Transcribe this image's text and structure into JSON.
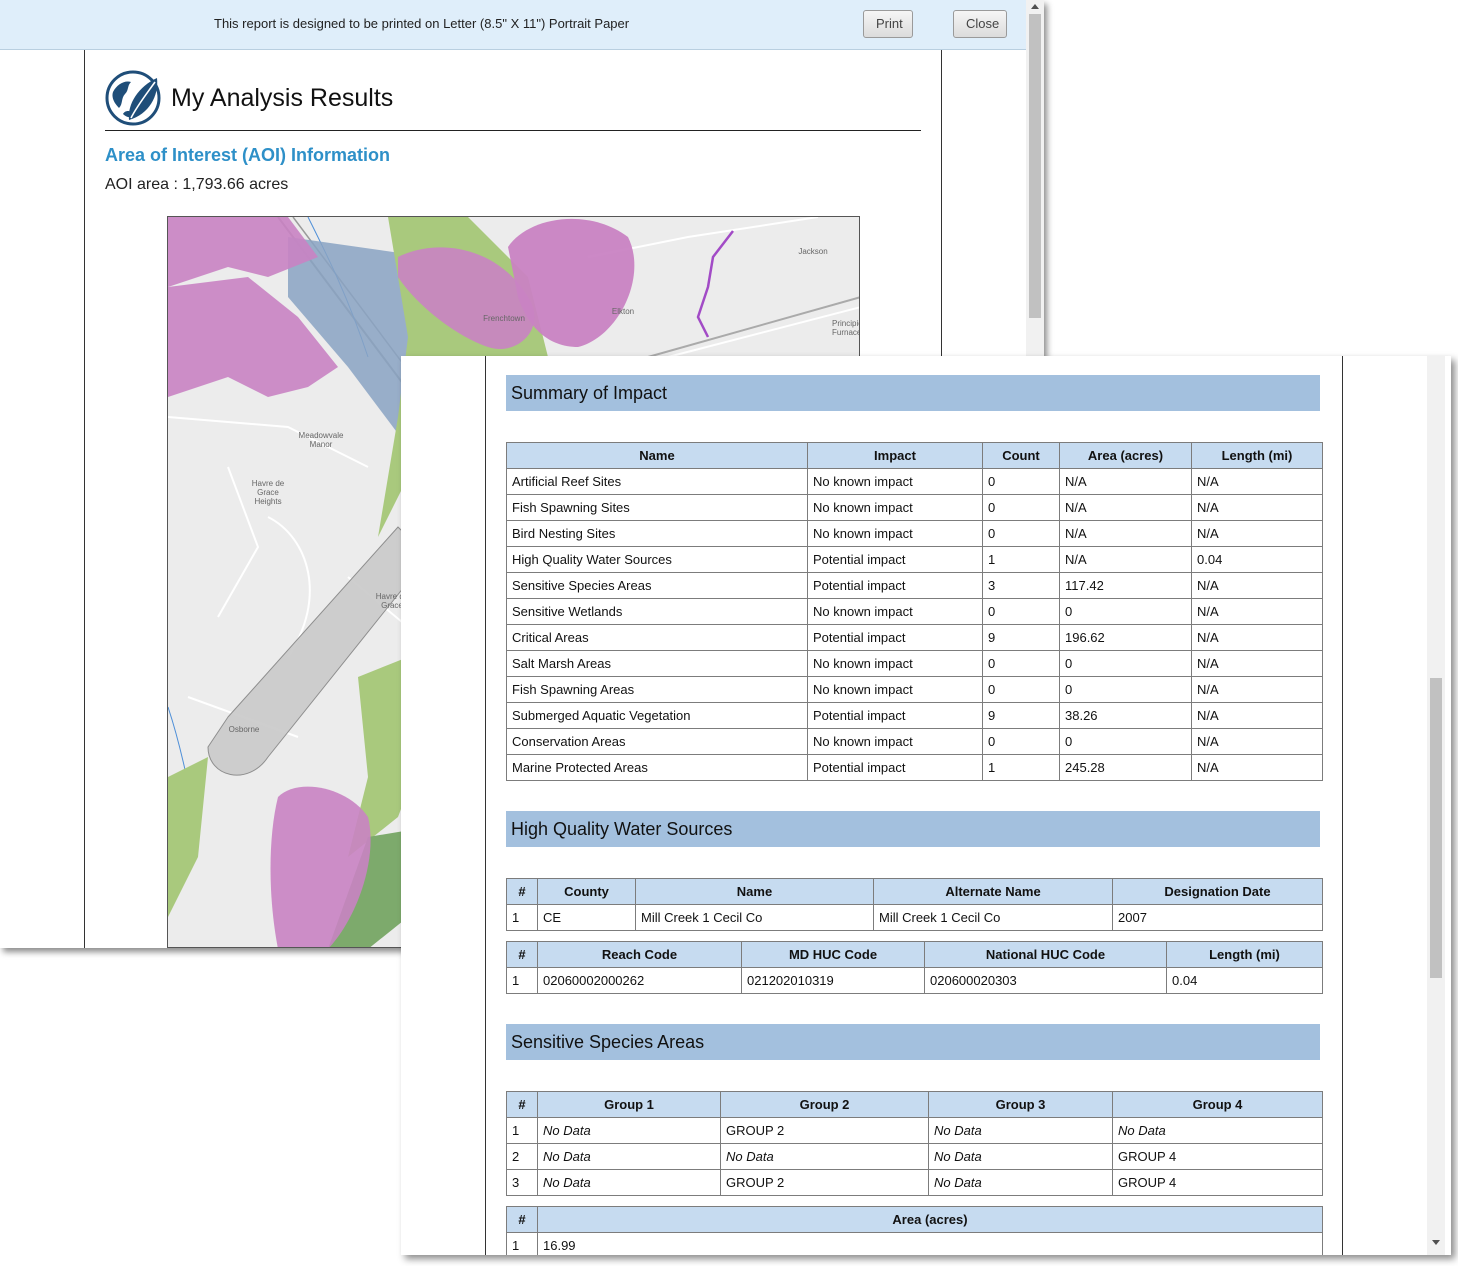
{
  "print_bar": {
    "message": "This report is designed to be printed on Letter (8.5\" X 11\") Portrait Paper",
    "print_label": "Print",
    "close_label": "Close"
  },
  "report": {
    "title": "My Analysis Results",
    "aoi_heading": "Area of Interest (AOI) Information",
    "aoi_area": "AOI area : 1,793.66 acres"
  },
  "map": {
    "labels": [
      "Jackson",
      "Frenchtown",
      "Elkton",
      "Principio Furnace",
      "Meadowvale Manor",
      "Havre de Grace Heights",
      "Havre de Grace",
      "Osborne"
    ],
    "colors": {
      "purple": "#c983c3",
      "green": "#a9c97d",
      "blue": "#8aa3c3",
      "grey": "#c9c9c9",
      "base": "#ececec"
    }
  },
  "summary": {
    "heading": "Summary of Impact",
    "columns": [
      "Name",
      "Impact",
      "Count",
      "Area (acres)",
      "Length (mi)"
    ],
    "rows": [
      [
        "Artificial Reef Sites",
        "No known impact",
        "0",
        "N/A",
        "N/A"
      ],
      [
        "Fish Spawning Sites",
        "No known impact",
        "0",
        "N/A",
        "N/A"
      ],
      [
        "Bird Nesting Sites",
        "No known impact",
        "0",
        "N/A",
        "N/A"
      ],
      [
        "High Quality Water Sources",
        "Potential impact",
        "1",
        "N/A",
        "0.04"
      ],
      [
        "Sensitive Species Areas",
        "Potential impact",
        "3",
        "117.42",
        "N/A"
      ],
      [
        "Sensitive Wetlands",
        "No known impact",
        "0",
        "0",
        "N/A"
      ],
      [
        "Critical Areas",
        "Potential impact",
        "9",
        "196.62",
        "N/A"
      ],
      [
        "Salt Marsh Areas",
        "No known impact",
        "0",
        "0",
        "N/A"
      ],
      [
        "Fish Spawning Areas",
        "No known impact",
        "0",
        "0",
        "N/A"
      ],
      [
        "Submerged Aquatic Vegetation",
        "Potential impact",
        "9",
        "38.26",
        "N/A"
      ],
      [
        "Conservation Areas",
        "No known impact",
        "0",
        "0",
        "N/A"
      ],
      [
        "Marine Protected Areas",
        "Potential impact",
        "1",
        "245.28",
        "N/A"
      ]
    ]
  },
  "water": {
    "heading": "High Quality Water Sources",
    "table1": {
      "columns": [
        "#",
        "County",
        "Name",
        "Alternate Name",
        "Designation Date"
      ],
      "rows": [
        [
          "1",
          "CE",
          "Mill Creek 1 Cecil Co",
          "Mill Creek 1 Cecil Co",
          "2007"
        ]
      ]
    },
    "table2": {
      "columns": [
        "#",
        "Reach Code",
        "MD HUC Code",
        "National HUC Code",
        "Length (mi)"
      ],
      "rows": [
        [
          "1",
          "02060002000262",
          "021202010319",
          "020600020303",
          "0.04"
        ]
      ]
    }
  },
  "species": {
    "heading": "Sensitive Species Areas",
    "table1": {
      "columns": [
        "#",
        "Group 1",
        "Group 2",
        "Group 3",
        "Group 4"
      ],
      "rows": [
        [
          "1",
          "No Data",
          "GROUP 2",
          "No Data",
          "No Data"
        ],
        [
          "2",
          "No Data",
          "No Data",
          "No Data",
          "GROUP 4"
        ],
        [
          "3",
          "No Data",
          "GROUP 2",
          "No Data",
          "GROUP 4"
        ]
      ]
    },
    "table2": {
      "columns": [
        "#",
        "Area (acres)"
      ],
      "rows": [
        [
          "1",
          "16.99"
        ]
      ]
    }
  }
}
